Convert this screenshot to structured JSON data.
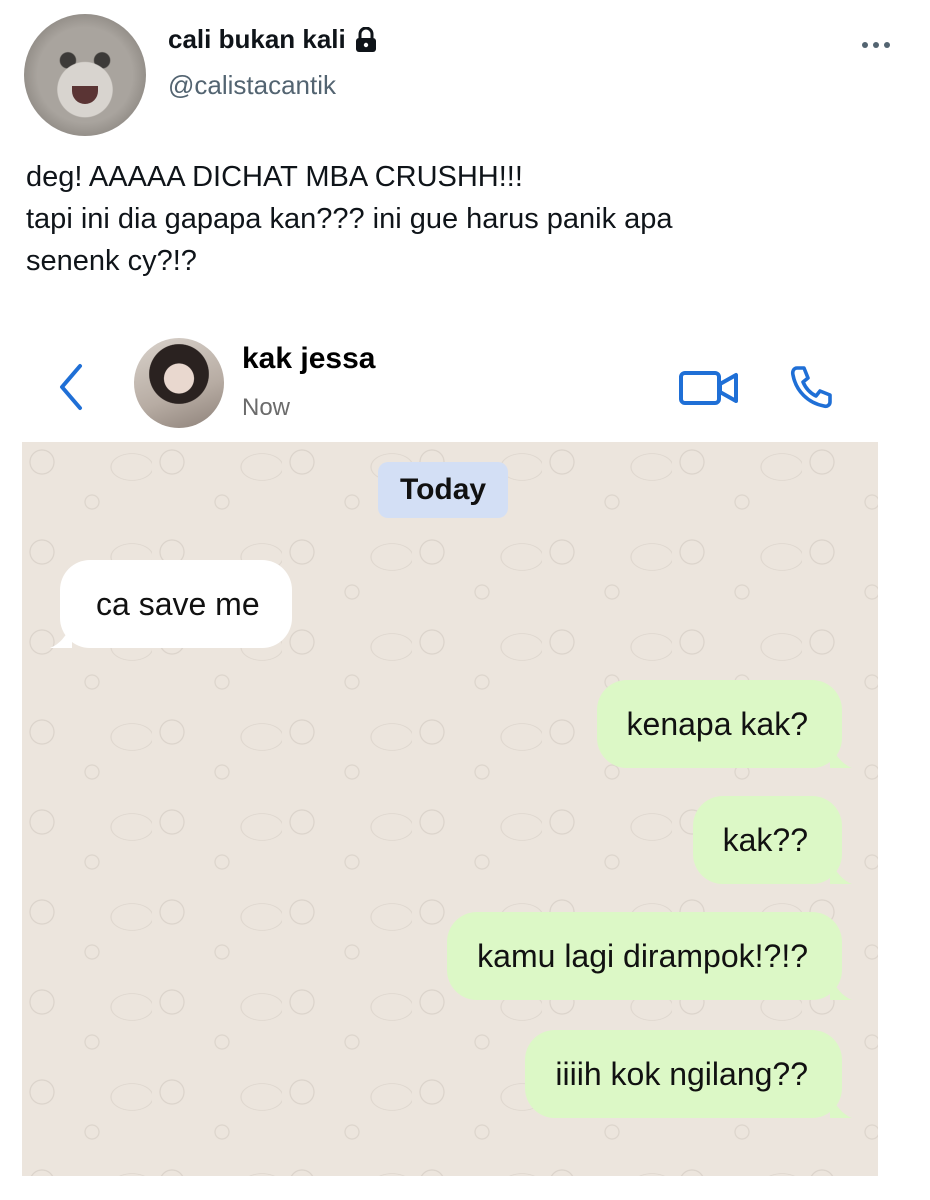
{
  "tweet": {
    "display_name": "cali bukan kali",
    "handle": "@calistacantik",
    "text_lines": [
      "deg! AAAAA DICHAT MBA CRUSHH!!!",
      "tapi ini dia gapapa kan??? ini gue harus panik apa",
      "senenk cy?!?"
    ],
    "icons": [
      "lock-icon",
      "more-options-icon"
    ]
  },
  "chat": {
    "contact_name": "kak jessa",
    "status": "Now",
    "date_separator": "Today",
    "accent_color": "#1f6fd6",
    "incoming_bubble_color": "#ffffff",
    "outgoing_bubble_color": "#dcf8c6",
    "icons": [
      "back-chevron-icon",
      "video-call-icon",
      "phone-call-icon"
    ],
    "messages": [
      {
        "direction": "incoming",
        "text": "ca save me"
      },
      {
        "direction": "outgoing",
        "text": "kenapa kak?"
      },
      {
        "direction": "outgoing",
        "text": "kak??"
      },
      {
        "direction": "outgoing",
        "text": "kamu lagi dirampok!?!?"
      },
      {
        "direction": "outgoing",
        "text": "iiiih kok ngilang??"
      }
    ]
  }
}
